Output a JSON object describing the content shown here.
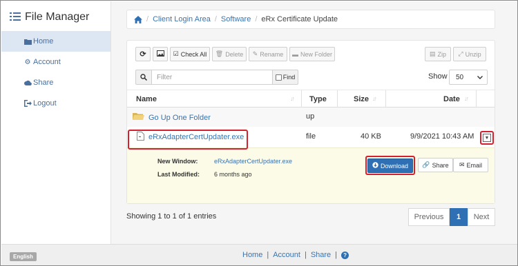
{
  "sidebar": {
    "brand": "File Manager",
    "items": [
      {
        "label": "Home",
        "icon": "folder-icon",
        "active": true
      },
      {
        "label": "Account",
        "icon": "gear-icon",
        "active": false
      },
      {
        "label": "Share",
        "icon": "cloud-icon",
        "active": false
      },
      {
        "label": "Logout",
        "icon": "logout-icon",
        "active": false
      }
    ]
  },
  "breadcrumb": {
    "home_icon": "home-icon",
    "items": [
      "Client Login Area",
      "Software"
    ],
    "current": "eRx Certificate Update"
  },
  "toolbar": {
    "check_all": "Check All",
    "delete": "Delete",
    "rename": "Rename",
    "new_folder": "New Folder",
    "zip": "Zip",
    "unzip": "Unzip"
  },
  "filter": {
    "placeholder": "Filter",
    "find_label": "Find"
  },
  "show": {
    "label": "Show",
    "value": "50"
  },
  "table": {
    "headers": {
      "name": "Name",
      "type": "Type",
      "size": "Size",
      "date": "Date"
    },
    "up_row": {
      "name": "Go Up One Folder",
      "type": "up"
    },
    "file_row": {
      "name": "eRxAdapterCertUpdater.exe",
      "type": "file",
      "size": "40 KB",
      "date": "9/9/2021 10:43 AM"
    }
  },
  "details": {
    "new_window_label": "New Window:",
    "new_window_value": "eRxAdapterCertUpdater.exe",
    "last_modified_label": "Last Modified:",
    "last_modified_value": "6 months ago",
    "download": "Download",
    "share": "Share",
    "email": "Email"
  },
  "footer": {
    "info": "Showing 1 to 1 of 1 entries",
    "previous": "Previous",
    "page": "1",
    "next": "Next"
  },
  "bottom": {
    "language": "English",
    "home": "Home",
    "account": "Account",
    "share": "Share",
    "help_icon": "help-icon"
  },
  "colors": {
    "accent": "#2f6fb3",
    "link": "#3a73ad",
    "highlight": "#d4202e",
    "details_bg": "#fcfbe8"
  }
}
